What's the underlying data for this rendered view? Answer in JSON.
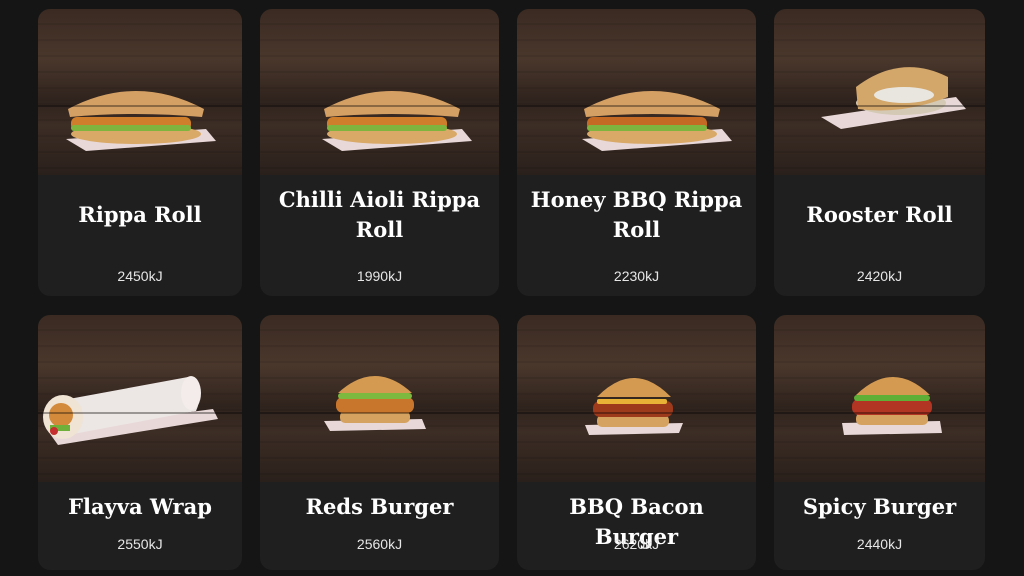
{
  "menu": {
    "items": [
      {
        "name": "Rippa Roll",
        "energy": "2450kJ",
        "food_icon": "chicken-roll-icon"
      },
      {
        "name": "Chilli Aioli Rippa Roll",
        "energy": "1990kJ",
        "food_icon": "chicken-roll-icon"
      },
      {
        "name": "Honey BBQ Rippa Roll",
        "energy": "2230kJ",
        "food_icon": "chicken-roll-icon"
      },
      {
        "name": "Rooster Roll",
        "energy": "2420kJ",
        "food_icon": "chicken-roll-icon"
      },
      {
        "name": "Flayva Wrap",
        "energy": "2550kJ",
        "food_icon": "wrap-icon"
      },
      {
        "name": "Reds Burger",
        "energy": "2560kJ",
        "food_icon": "burger-icon"
      },
      {
        "name": "BBQ Bacon Burger",
        "energy": "2620kJ",
        "food_icon": "burger-icon"
      },
      {
        "name": "Spicy Burger",
        "energy": "2440kJ",
        "food_icon": "burger-icon"
      }
    ]
  },
  "colors": {
    "page_background": "#151515",
    "card_background": "#1f1f20",
    "text": "#ffffff"
  }
}
